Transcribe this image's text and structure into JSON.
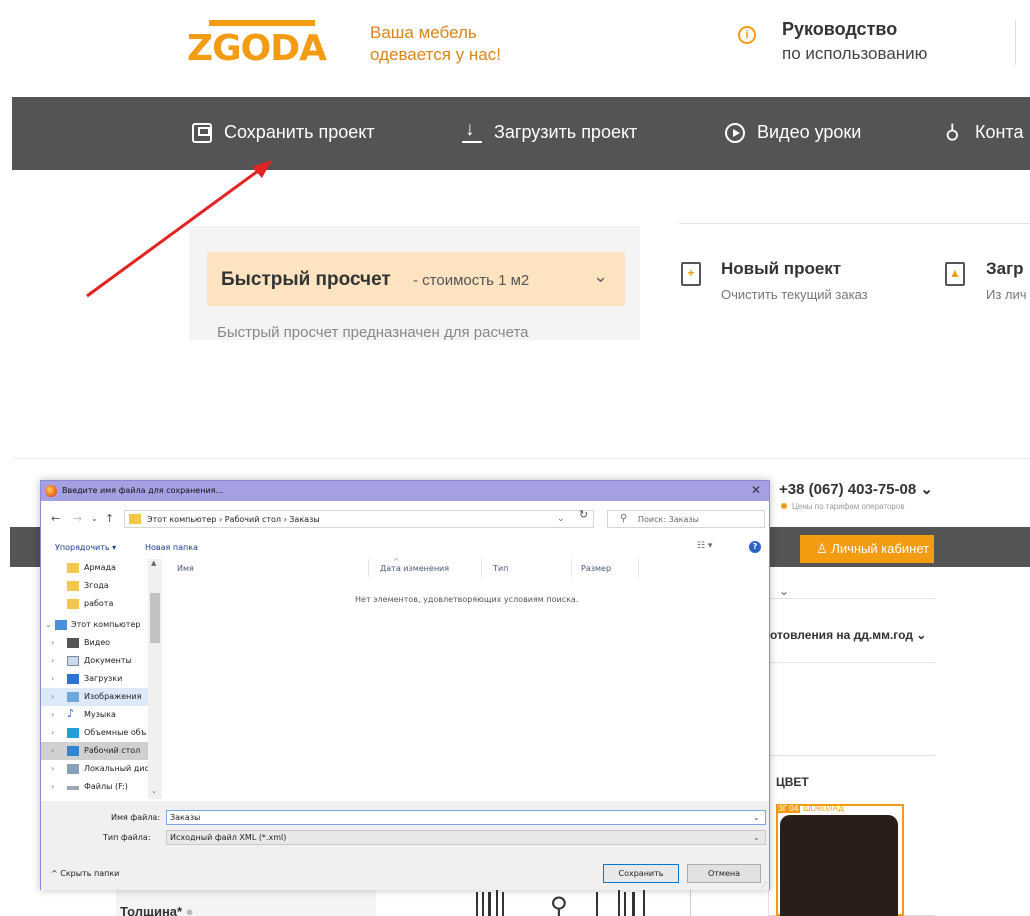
{
  "site": {
    "logo": "ZGODA",
    "slogan_line1": "Ваша мебель",
    "slogan_line2": "одевается у нас!",
    "guide_title": "Руководство",
    "guide_sub": "по использованию",
    "nav": {
      "save": "Сохранить проект",
      "load": "Загрузить проект",
      "video": "Видео уроки",
      "contacts": "Конта"
    },
    "quick": {
      "title": "Быстрый просчет",
      "subtitle": "- стоимость 1 м2",
      "body": "Быстрый просчет предназначен для расчета"
    },
    "new_project": {
      "title": "Новый проект",
      "sub": "Очистить текущий заказ"
    },
    "load_project": {
      "title": "Загр",
      "sub": "Из лич"
    }
  },
  "lower": {
    "phone": "+38 (067) 403-75-08",
    "phone_note": "Цены по тарифам операторов",
    "cabinet": "Личный кабинет",
    "prod_date": "отовления на дд.мм.год",
    "color_title": "ЦВЕТ",
    "swatch_code": "ЗГ 04",
    "swatch_name": "ШОКОЛАД",
    "thickness": "Толщина*",
    "colors": {
      "accent": "#f39c12",
      "nav": "#545454",
      "swatch": "#2b1d17"
    }
  },
  "dialog": {
    "title": "Введите имя файла для сохранения...",
    "path": "Этот компьютер  ›  Рабочий стол  ›  Заказы",
    "search_placeholder": "Поиск: Заказы",
    "organize": "Упорядочить ▾",
    "new_folder": "Новая папка",
    "tree": [
      {
        "label": "Армада",
        "icon": "folder-icon"
      },
      {
        "label": "Згода",
        "icon": "folder-icon"
      },
      {
        "label": "работа",
        "icon": "folder-icon"
      },
      {
        "label": "Этот компьютер",
        "icon": "computer-icon"
      },
      {
        "label": "Видео",
        "icon": "video-icon"
      },
      {
        "label": "Документы",
        "icon": "documents-icon"
      },
      {
        "label": "Загрузки",
        "icon": "downloads-icon"
      },
      {
        "label": "Изображения",
        "icon": "pictures-icon"
      },
      {
        "label": "Музыка",
        "icon": "music-icon"
      },
      {
        "label": "Объемные объ",
        "icon": "3d-objects-icon"
      },
      {
        "label": "Рабочий стол",
        "icon": "desktop-icon"
      },
      {
        "label": "Локальный дис",
        "icon": "drive-icon"
      },
      {
        "label": "Файлы (F:)",
        "icon": "drive-icon"
      }
    ],
    "columns": {
      "name": "Имя",
      "date": "Дата изменения",
      "type": "Тип",
      "size": "Размер"
    },
    "empty_message": "Нет элементов, удовлетворяющих условиям поиска.",
    "filename_label": "Имя файла:",
    "filename_value": "Заказы",
    "filetype_label": "Тип файла:",
    "filetype_value": "Исходный файл XML (*.xml)",
    "hide_folders": "Скрыть папки",
    "save_button": "Сохранить",
    "cancel_button": "Отмена"
  }
}
